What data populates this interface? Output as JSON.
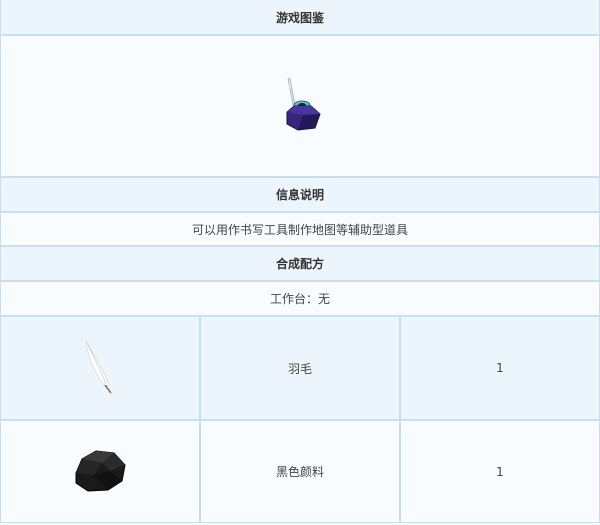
{
  "title": "游戏图鉴",
  "item": {
    "icon": "inkwell-quill-icon"
  },
  "info": {
    "heading": "信息说明",
    "description": "可以用作书写工具制作地图等辅助型道具"
  },
  "recipe": {
    "heading": "合成配方",
    "bench": "工作台：无",
    "ingredients": [
      {
        "icon": "feather-icon",
        "name": "羽毛",
        "count": "1"
      },
      {
        "icon": "black-dye-icon",
        "name": "黑色颜料",
        "count": "1"
      }
    ]
  }
}
